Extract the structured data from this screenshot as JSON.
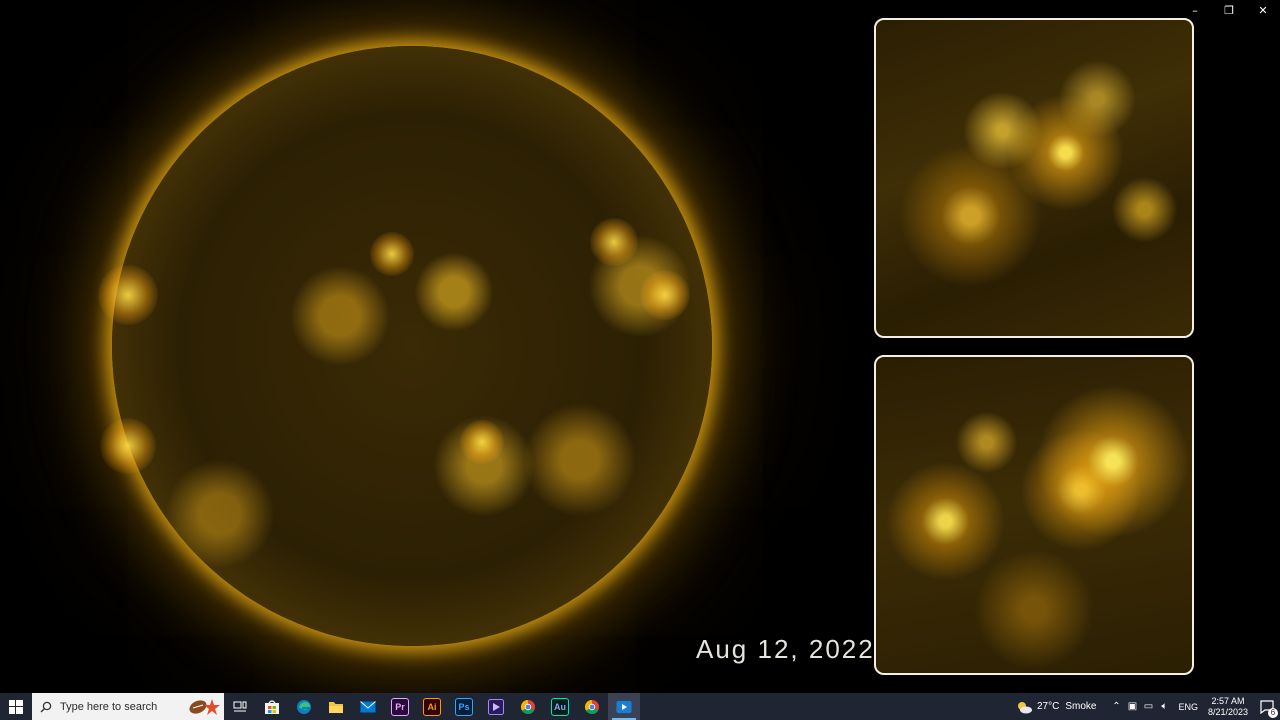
{
  "window": {
    "controls": [
      "–",
      "❐",
      "✕"
    ]
  },
  "video": {
    "date_label": "Aug 12, 2022"
  },
  "taskbar": {
    "search_placeholder": "Type here to search",
    "apps": [
      {
        "name": "task-view",
        "label": ""
      },
      {
        "name": "microsoft-store",
        "label": ""
      },
      {
        "name": "edge",
        "label": ""
      },
      {
        "name": "file-explorer",
        "label": ""
      },
      {
        "name": "mail",
        "label": ""
      },
      {
        "name": "premiere-pro",
        "label": "Pr"
      },
      {
        "name": "illustrator",
        "label": "Ai"
      },
      {
        "name": "photoshop",
        "label": "Ps"
      },
      {
        "name": "after-effects-like",
        "label": ""
      },
      {
        "name": "chrome",
        "label": ""
      },
      {
        "name": "audition",
        "label": "Au"
      },
      {
        "name": "chrome-2",
        "label": ""
      },
      {
        "name": "active-app",
        "label": ""
      }
    ],
    "weather": {
      "temp": "27°C",
      "condition": "Smoke"
    },
    "language": "ENG",
    "time": "2:57 AM",
    "date": "8/21/2023",
    "notification_count": "6"
  },
  "colors": {
    "taskbar_bg": "#1f2533",
    "sun_glow": "#e0a820",
    "inset_border": "#f3efe4"
  }
}
